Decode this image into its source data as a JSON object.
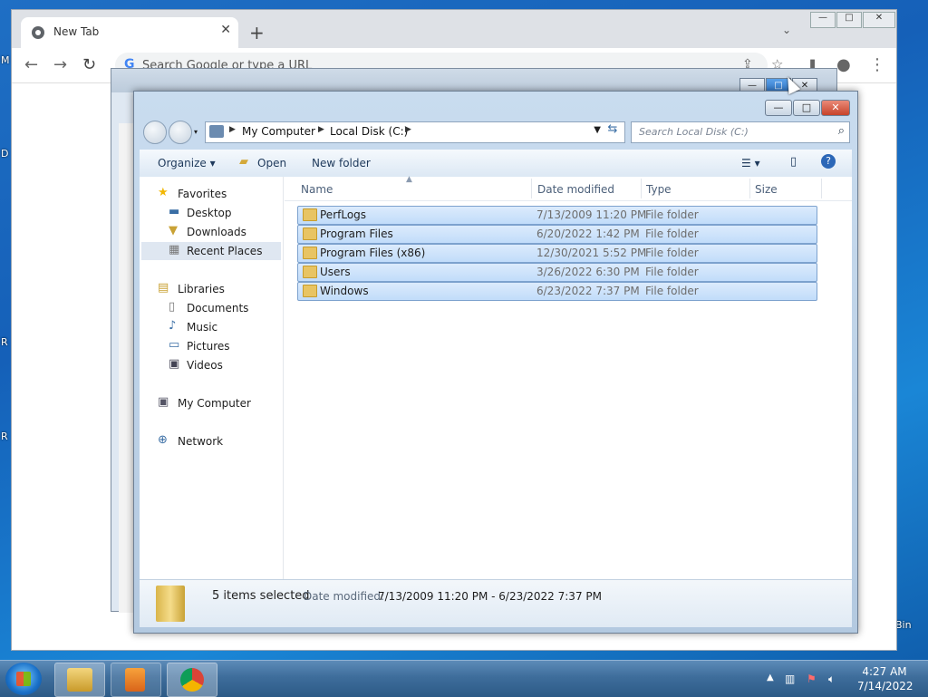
{
  "desktop": {
    "frag_m": "M",
    "frag_d": "D",
    "frag_r1": "R",
    "frag_r2": "R",
    "bin": "Bin"
  },
  "chrome": {
    "tab_title": "New Tab",
    "tab_close": "✕",
    "new_tab": "+",
    "omnibox_placeholder": "Search Google or type a URL",
    "omnibox_g": "G",
    "controls": {
      "min": "—",
      "max": "□",
      "close": "✕"
    }
  },
  "explorer": {
    "breadcrumb": [
      "My Computer",
      "Local Disk (C:)"
    ],
    "search_placeholder": "Search Local Disk (C:)",
    "toolbar": {
      "organize": "Organize",
      "open": "Open",
      "new_folder": "New folder"
    },
    "nav": {
      "favorites": "Favorites",
      "favorites_items": [
        "Desktop",
        "Downloads",
        "Recent Places"
      ],
      "libraries": "Libraries",
      "libraries_items": [
        "Documents",
        "Music",
        "Pictures",
        "Videos"
      ],
      "my_computer": "My Computer",
      "network": "Network"
    },
    "columns": {
      "name": "Name",
      "date": "Date modified",
      "type": "Type",
      "size": "Size"
    },
    "files": [
      {
        "name": "PerfLogs",
        "date": "7/13/2009 11:20 PM",
        "type": "File folder"
      },
      {
        "name": "Program Files",
        "date": "6/20/2022 1:42 PM",
        "type": "File folder"
      },
      {
        "name": "Program Files (x86)",
        "date": "12/30/2021 5:52 PM",
        "type": "File folder"
      },
      {
        "name": "Users",
        "date": "3/26/2022 6:30 PM",
        "type": "File folder"
      },
      {
        "name": "Windows",
        "date": "6/23/2022 7:37 PM",
        "type": "File folder"
      }
    ],
    "details": {
      "count": "5 items selected",
      "date_label": "Date modified:",
      "date_value": "7/13/2009 11:20 PM - 6/23/2022 7:37 PM"
    }
  },
  "taskbar": {
    "time": "4:27 AM",
    "date": "7/14/2022"
  },
  "colors": {
    "selection": "#c1dcfa",
    "taskbar": "#3e6d9b",
    "close": "#c7432a"
  }
}
